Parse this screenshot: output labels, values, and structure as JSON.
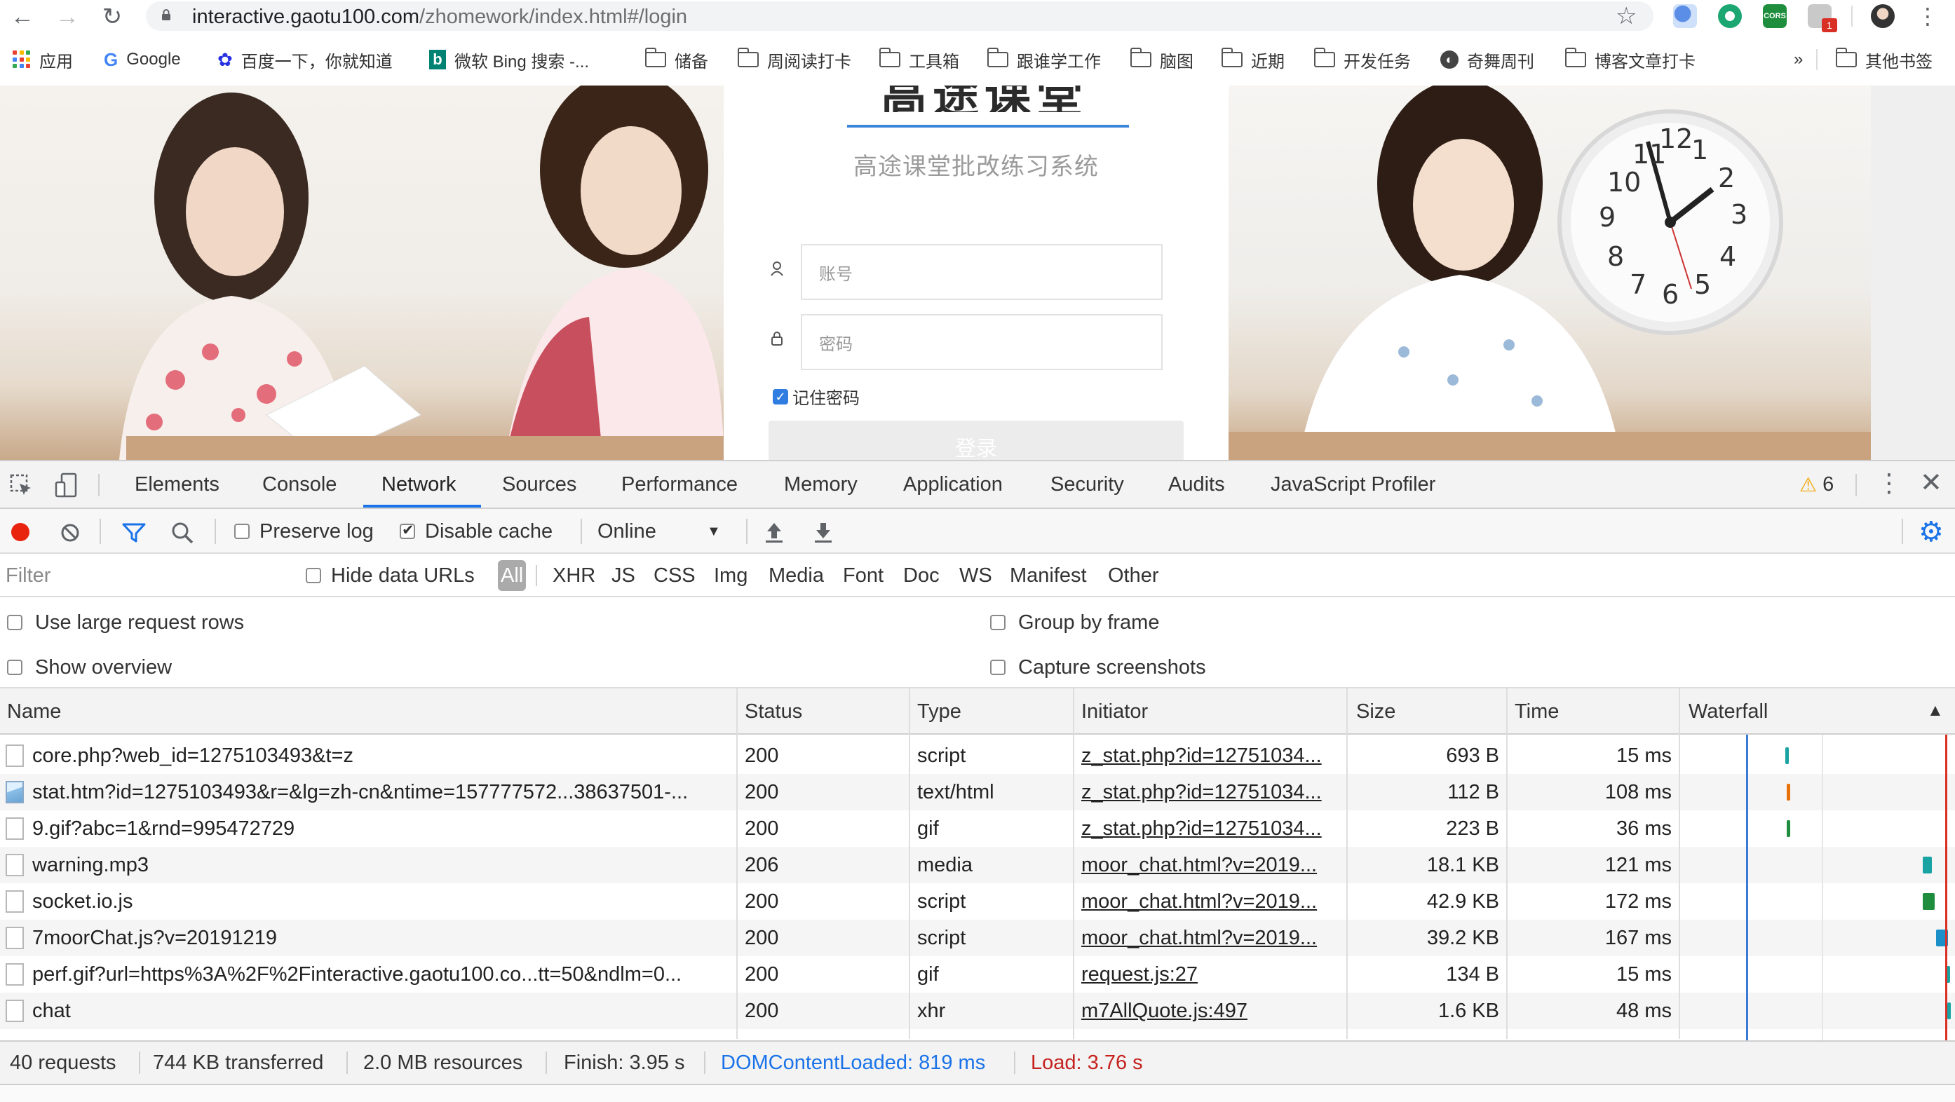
{
  "browser": {
    "url_host": "interactive.gaotu100.com",
    "url_path": "/zhomework/index.html#/login",
    "bookmarks": [
      {
        "label": "应用",
        "icon": "apps-grid-icon"
      },
      {
        "label": "Google",
        "icon": "google-icon"
      },
      {
        "label": "百度一下，你就知道",
        "icon": "baidu-paw-icon"
      },
      {
        "label": "微软 Bing 搜索 -...",
        "icon": "bing-icon"
      },
      {
        "label": "储备",
        "icon": "folder-icon"
      },
      {
        "label": "周阅读打卡",
        "icon": "folder-icon"
      },
      {
        "label": "工具箱",
        "icon": "folder-icon"
      },
      {
        "label": "跟谁学工作",
        "icon": "folder-icon"
      },
      {
        "label": "脑图",
        "icon": "folder-icon"
      },
      {
        "label": "近期",
        "icon": "folder-icon"
      },
      {
        "label": "开发任务",
        "icon": "folder-icon"
      },
      {
        "label": "奇舞周刊",
        "icon": "globe-icon"
      },
      {
        "label": "博客文章打卡",
        "icon": "folder-icon"
      }
    ],
    "bookmarks_overflow": "»",
    "other_bookmarks": "其他书签",
    "extension_badge": "1",
    "cors_ext_label": "CORS"
  },
  "login": {
    "logo_text": "高途课堂",
    "subtitle": "高途课堂批改练习系统",
    "account_placeholder": "账号",
    "password_placeholder": "密码",
    "remember_label": "记住密码",
    "login_button": "登录"
  },
  "devtools": {
    "tabs": [
      "Elements",
      "Console",
      "Network",
      "Sources",
      "Performance",
      "Memory",
      "Application",
      "Security",
      "Audits",
      "JavaScript Profiler"
    ],
    "active_tab": "Network",
    "warning_count": "6",
    "toolbar": {
      "preserve_log": "Preserve log",
      "disable_cache": "Disable cache",
      "throttling": "Online"
    },
    "filter": {
      "placeholder": "Filter",
      "hide_data_urls": "Hide data URLs",
      "types": [
        "All",
        "XHR",
        "JS",
        "CSS",
        "Img",
        "Media",
        "Font",
        "Doc",
        "WS",
        "Manifest",
        "Other"
      ]
    },
    "options": {
      "large_rows": "Use large request rows",
      "show_overview": "Show overview",
      "group_by_frame": "Group by frame",
      "capture_screenshots": "Capture screenshots"
    },
    "columns": [
      "Name",
      "Status",
      "Type",
      "Initiator",
      "Size",
      "Time",
      "Waterfall"
    ],
    "requests": [
      {
        "name": "core.php?web_id=1275103493&t=z",
        "status": "200",
        "type": "script",
        "initiator": "z_stat.php?id=12751034...",
        "size": "693 B",
        "time": "15 ms",
        "wf_start": 0.39,
        "wf_len": 0.01,
        "wf_color": "#1aa3a3",
        "icon": "file"
      },
      {
        "name": "stat.htm?id=1275103493&r=&lg=zh-cn&ntime=157777572...38637501-...",
        "status": "200",
        "type": "text/html",
        "initiator": "z_stat.php?id=12751034...",
        "size": "112 B",
        "time": "108 ms",
        "wf_start": 0.395,
        "wf_len": 0.012,
        "wf_color": "#e8710a",
        "icon": "image"
      },
      {
        "name": "9.gif?abc=1&rnd=995472729",
        "status": "200",
        "type": "gif",
        "initiator": "z_stat.php?id=12751034...",
        "size": "223 B",
        "time": "36 ms",
        "wf_start": 0.395,
        "wf_len": 0.008,
        "wf_color": "#1e8e3e",
        "icon": "file"
      },
      {
        "name": "warning.mp3",
        "status": "206",
        "type": "media",
        "initiator": "moor_chat.html?v=2019...",
        "size": "18.1 KB",
        "time": "121 ms",
        "wf_start": 0.905,
        "wf_len": 0.035,
        "wf_color": "#1aa3a3",
        "icon": "file"
      },
      {
        "name": "socket.io.js",
        "status": "200",
        "type": "script",
        "initiator": "moor_chat.html?v=2019...",
        "size": "42.9 KB",
        "time": "172 ms",
        "wf_start": 0.905,
        "wf_len": 0.045,
        "wf_color": "#1e8e3e",
        "icon": "file"
      },
      {
        "name": "7moorChat.js?v=20191219",
        "status": "200",
        "type": "script",
        "initiator": "moor_chat.html?v=2019...",
        "size": "39.2 KB",
        "time": "167 ms",
        "wf_start": 0.955,
        "wf_len": 0.045,
        "wf_color": "#1a8fc8",
        "icon": "file"
      },
      {
        "name": "perf.gif?url=https%3A%2F%2Finteractive.gaotu100.co...tt=50&ndlm=0...",
        "status": "200",
        "type": "gif",
        "initiator": "request.js:27",
        "size": "134 B",
        "time": "15 ms",
        "wf_start": 0.995,
        "wf_len": 0.005,
        "wf_color": "#1aa3a3",
        "icon": "file"
      },
      {
        "name": "chat",
        "status": "200",
        "type": "xhr",
        "initiator": "m7AllQuote.js:497",
        "size": "1.6 KB",
        "time": "48 ms",
        "wf_start": 0.998,
        "wf_len": 0.002,
        "wf_color": "#1aa3a3",
        "icon": "file"
      }
    ],
    "status_bar": {
      "requests": "40 requests",
      "transferred": "744 KB transferred",
      "resources": "2.0 MB resources",
      "finish": "Finish: 3.95 s",
      "dom_content_loaded": "DOMContentLoaded: 819 ms",
      "load": "Load: 3.76 s"
    }
  },
  "colors": {
    "accent": "#1a73e8",
    "dcl_blue": "#1a73e8",
    "load_red": "#c5221f",
    "record_red": "#e8230e",
    "warning": "#f2a600"
  }
}
